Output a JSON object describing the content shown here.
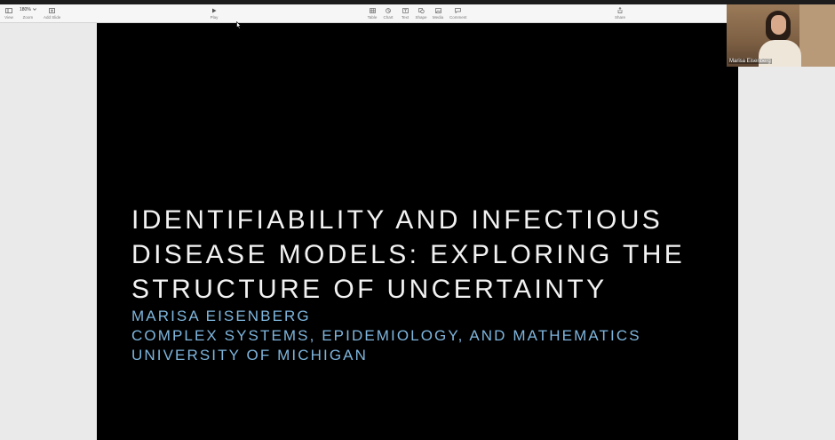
{
  "toolbar": {
    "view_label": "View",
    "zoom_value": "180%",
    "zoom_label": "Zoom",
    "add_slide_label": "Add Slide",
    "play_label": "Play",
    "table_label": "Table",
    "chart_label": "Chart",
    "text_label": "Text",
    "shape_label": "Shape",
    "media_label": "Media",
    "comment_label": "Comment",
    "share_label": "Share"
  },
  "slide": {
    "title": "IDENTIFIABILITY AND INFECTIOUS\nDISEASE MODELS: EXPLORING THE\nSTRUCTURE OF UNCERTAINTY",
    "author": "MARISA EISENBERG",
    "department": "COMPLEX SYSTEMS, EPIDEMIOLOGY, AND MATHEMATICS",
    "university": "UNIVERSITY OF MICHIGAN",
    "title_color": "#f2f2f2",
    "subtitle_color": "#7fb6de"
  },
  "video": {
    "participant_name": "Marisa Eisenberg"
  },
  "icons": {
    "view": "sidebar-icon",
    "zoom": "chevron-down-icon",
    "add_slide": "plus-square-icon",
    "play": "play-icon",
    "table": "table-icon",
    "chart": "chart-icon",
    "text": "text-icon",
    "shape": "shape-icon",
    "media": "media-icon",
    "comment": "comment-icon",
    "share": "share-icon"
  }
}
